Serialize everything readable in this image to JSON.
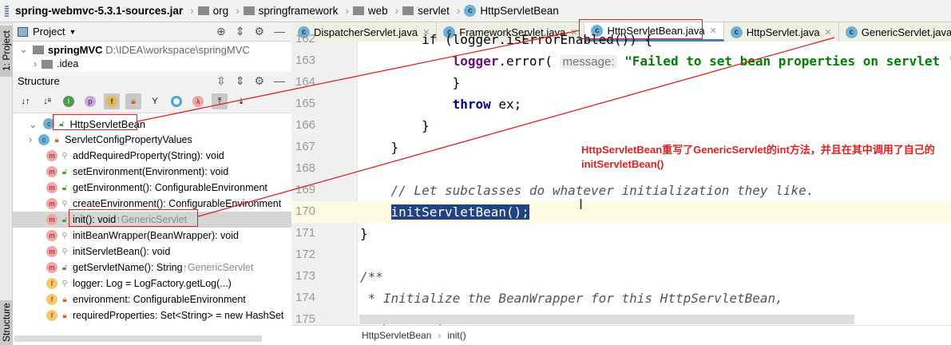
{
  "breadcrumbs": [
    "spring-webmvc-5.3.1-sources.jar",
    "org",
    "springframework",
    "web",
    "servlet",
    "HttpServletBean"
  ],
  "side_stripe": {
    "project": "1: Project",
    "structure": "Structure"
  },
  "project_panel": {
    "title": "Project",
    "root": "springMVC",
    "root_path": "D:\\IDEA\\workspace\\springMVC",
    "child": ".idea"
  },
  "structure_panel": {
    "title": "Structure",
    "toolbar_icons": [
      "sort-by-visibility",
      "sort-alpha",
      "inherited",
      "properties",
      "fields",
      "non-public",
      "anonymous",
      "lambdas",
      "autoscroll-to-source",
      "autoscroll-from-source"
    ],
    "root": "HttpServletBean",
    "items": [
      {
        "kind": "c",
        "access": "pri",
        "label": "ServletConfigPropertyValues",
        "inherited": ""
      },
      {
        "kind": "m",
        "access": "pkg",
        "label": "addRequiredProperty(String): void",
        "inherited": ""
      },
      {
        "kind": "m",
        "access": "pub",
        "label": "setEnvironment(Environment): void",
        "inherited": ""
      },
      {
        "kind": "m",
        "access": "pub",
        "label": "getEnvironment(): ConfigurableEnvironment",
        "inherited": ""
      },
      {
        "kind": "m",
        "access": "pkg",
        "label": "createEnvironment(): ConfigurableEnvironment",
        "inherited": ""
      },
      {
        "kind": "m",
        "access": "pub",
        "label": "init(): void",
        "inherited": "↑GenericServlet",
        "selected": true
      },
      {
        "kind": "m",
        "access": "pkg",
        "label": "initBeanWrapper(BeanWrapper): void",
        "inherited": ""
      },
      {
        "kind": "m",
        "access": "pkg",
        "label": "initServletBean(): void",
        "inherited": ""
      },
      {
        "kind": "m",
        "access": "pub",
        "label": "getServletName(): String",
        "inherited": "↑GenericServlet"
      },
      {
        "kind": "f",
        "access": "pkg",
        "label": "logger: Log = LogFactory.getLog(...)",
        "inherited": ""
      },
      {
        "kind": "f",
        "access": "pri",
        "label": "environment: ConfigurableEnvironment",
        "inherited": ""
      },
      {
        "kind": "f",
        "access": "pri",
        "label": "requiredProperties: Set<String> = new HashSet",
        "inherited": ""
      }
    ]
  },
  "tabs": [
    {
      "label": "DispatcherServlet.java",
      "active": false
    },
    {
      "label": "FrameworkServlet.java",
      "active": false
    },
    {
      "label": "HttpServletBean.java",
      "active": true
    },
    {
      "label": "HttpServlet.java",
      "active": false
    },
    {
      "label": "GenericServlet.java",
      "active": false
    }
  ],
  "code": [
    {
      "n": "162",
      "parts": [
        [
          "        ",
          ""
        ],
        [
          "if (logger.isErrorEnabled()) {",
          ""
        ]
      ]
    },
    {
      "n": "163",
      "parts": [
        [
          "            ",
          ""
        ],
        [
          "logger",
          "fld"
        ],
        [
          ".error( ",
          ""
        ],
        [
          "message:",
          "hint"
        ],
        [
          " ",
          ""
        ],
        [
          "\"Failed to set bean properties on servlet '\"",
          "str"
        ]
      ]
    },
    {
      "n": "164",
      "parts": [
        [
          "            }",
          ""
        ]
      ]
    },
    {
      "n": "165",
      "parts": [
        [
          "            ",
          ""
        ],
        [
          "throw",
          "kw"
        ],
        [
          " ex;",
          ""
        ]
      ]
    },
    {
      "n": "166",
      "parts": [
        [
          "        }",
          ""
        ]
      ]
    },
    {
      "n": "167",
      "parts": [
        [
          "    }",
          ""
        ]
      ]
    },
    {
      "n": "168",
      "parts": []
    },
    {
      "n": "169",
      "parts": [
        [
          "    ",
          ""
        ],
        [
          "// Let subclasses do whatever initialization they like.",
          "cm"
        ]
      ]
    },
    {
      "n": "170",
      "parts": [
        [
          "    ",
          ""
        ],
        [
          "initServletBean();",
          "selc"
        ]
      ]
    },
    {
      "n": "171",
      "parts": [
        [
          "}",
          ""
        ]
      ]
    },
    {
      "n": "172",
      "parts": []
    },
    {
      "n": "173",
      "parts": [
        [
          "/**",
          "cm"
        ]
      ]
    },
    {
      "n": "174",
      "parts": [
        [
          " * Initialize the BeanWrapper for this HttpServletBean,",
          "cm"
        ]
      ]
    },
    {
      "n": "175",
      "parts": [
        [
          " * possibly with custom editors.",
          "cm"
        ]
      ]
    }
  ],
  "annotation": "HttpServletBean重写了GenericServlet的int方法，并且在其中调用了自己的initServletBean()",
  "status_breadcrumb": [
    "HttpServletBean",
    "init()"
  ],
  "colors": {
    "annotation": "#e02020",
    "selection": "#214283",
    "accent": "#4a7fb8"
  }
}
